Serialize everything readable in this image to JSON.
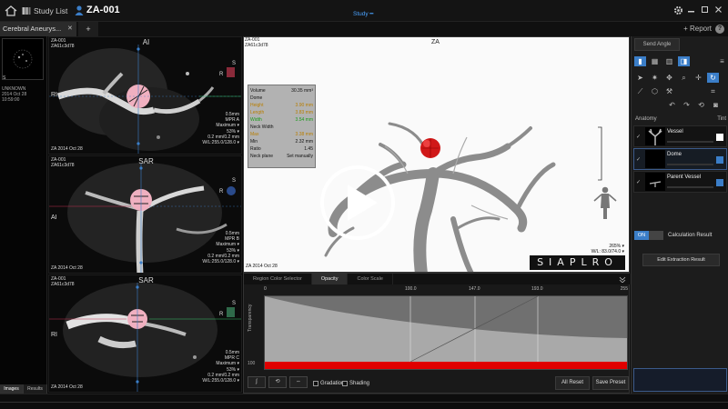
{
  "topbar": {
    "study_list": "Study List",
    "patient_id": "ZA-001",
    "center_label": "Study ━"
  },
  "tabbar": {
    "tab_label": "Cerebral Aneurys...",
    "add": "+",
    "report": "+ Report"
  },
  "thumbnails": {
    "marker": "S",
    "meta": [
      "UNKNOWN",
      "2014 Oct 28",
      "10:59:00"
    ],
    "tabs": [
      "Images",
      "Results"
    ]
  },
  "mpr": [
    {
      "id": "ZA-001",
      "sub": "ZA61c3d78",
      "orient_top": "AI",
      "orient_left": "RI",
      "info": [
        "0.5mm",
        "MPR A",
        "Maximum ▾",
        "53% ▾",
        "0.2 mm/0.2 mm",
        "W/L:255.0/128.0 ▾"
      ],
      "date": "ZA 2014 Oct 28",
      "ortho_top": "S",
      "ortho_left": "R"
    },
    {
      "id": "ZA-001",
      "sub": "ZA61c3d78",
      "orient_top": "SAR",
      "orient_left": "AI",
      "info": [
        "0.5mm",
        "MPR B",
        "Maximum ▾",
        "53% ▾",
        "0.2 mm/0.2 mm",
        "W/L:255.0/128.0 ▾"
      ],
      "date": "ZA 2014 Oct 28",
      "ortho_top": "S",
      "ortho_left": "R"
    },
    {
      "id": "ZA-001",
      "sub": "ZA61c3d78",
      "orient_top": "SAR",
      "orient_left": "RI",
      "info": [
        "0.5mm",
        "MPR C",
        "Maximum ▾",
        "53% ▾",
        "0.2 mm/0.2 mm",
        "W/L:255.0/128.0 ▾"
      ],
      "date": "ZA 2014 Oct 28",
      "ortho_top": "S",
      "ortho_left": "R"
    }
  ],
  "view3d": {
    "id": "ZA-001",
    "sub": "ZA61c3d78",
    "label": "ZA",
    "zoom": "265% ▾",
    "wl": "W/L: 83.0/74.0 ▾",
    "date": "ZA 2014 Oct 28",
    "orient_cube": "SIAPLRO",
    "measure": [
      {
        "k": "Volume",
        "v": "30.35 mm³",
        "style": ""
      },
      {
        "k": "Dome",
        "v": "",
        "style": ""
      },
      {
        "k": "Height",
        "v": "3.90 mm",
        "style": "hl"
      },
      {
        "k": "Length",
        "v": "3.83 mm",
        "style": "hl"
      },
      {
        "k": "Width",
        "v": "3.54 mm",
        "style": "hl2"
      },
      {
        "k": "Neck Width",
        "v": "",
        "style": ""
      },
      {
        "k": "Max",
        "v": "3.38 mm",
        "style": "hl"
      },
      {
        "k": "Min",
        "v": "2.32 mm",
        "style": ""
      },
      {
        "k": "Ratio",
        "v": "1.45",
        "style": ""
      },
      {
        "k": "Neck plane",
        "v": "Set manually",
        "style": ""
      }
    ]
  },
  "curve": {
    "tabs": [
      "Region Color Selector",
      "Opacity",
      "Color Scale"
    ],
    "active_tab": 1,
    "ticks": [
      "0",
      "100.0",
      "147.0",
      "193.0",
      "255"
    ],
    "ylabel": "Transparency",
    "y100": "100",
    "gradation": "Gradation",
    "shading": "Shading",
    "all_reset": "All Reset",
    "save_preset": "Save Preset",
    "accent": "#e00000"
  },
  "sidebar": {
    "send_angle": "Send Angle",
    "anatomy": "Anatomy",
    "tint": "Tint",
    "items": [
      {
        "label": "Vessel",
        "tint": "#ffffff"
      },
      {
        "label": "Dome",
        "tint": "#3b7ec8"
      },
      {
        "label": "Parent Vessel",
        "tint": "#3b7ec8"
      }
    ],
    "on": "ON",
    "calc_result": "Calculation Result",
    "edit_extraction": "Edit Extraction Result"
  }
}
